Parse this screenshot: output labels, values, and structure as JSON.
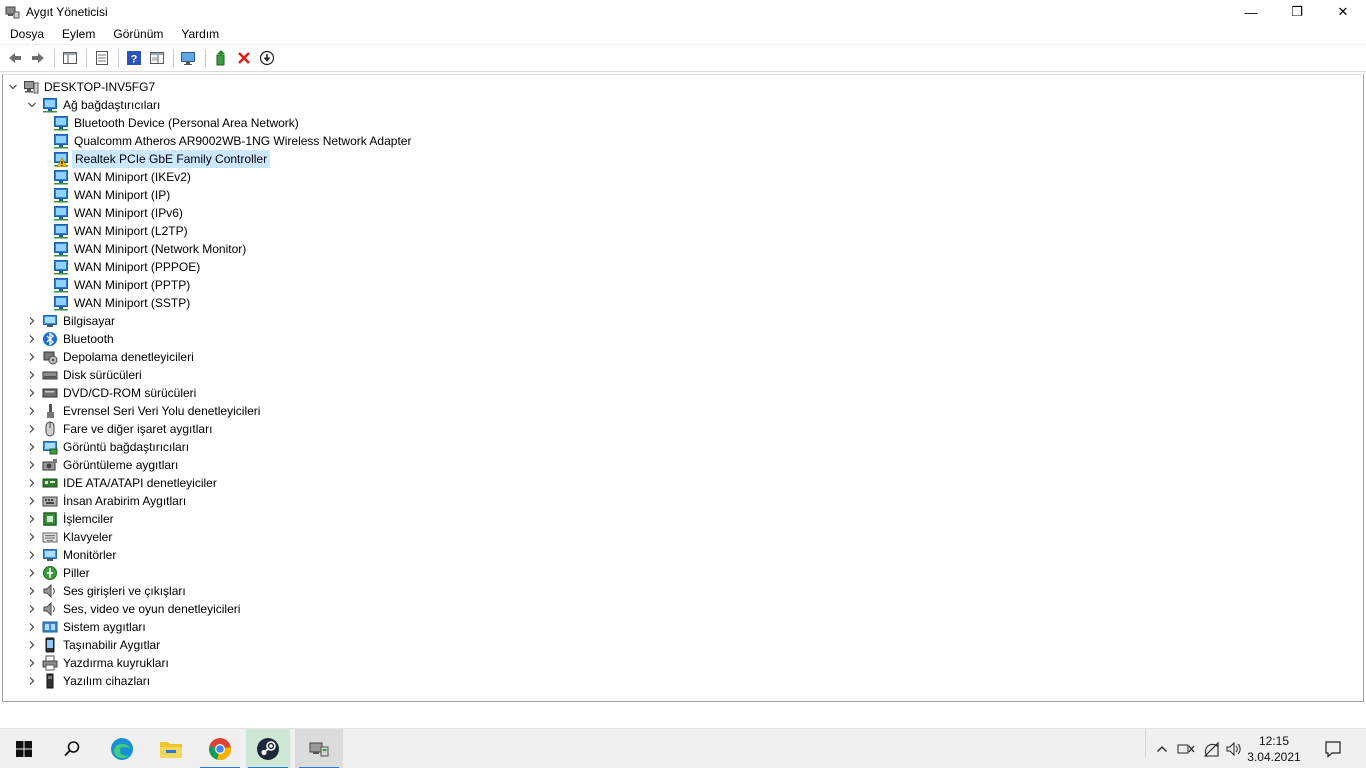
{
  "window": {
    "title": "Aygıt Yöneticisi",
    "minimize_glyph": "—",
    "maximize_glyph": "❐",
    "close_glyph": "✕"
  },
  "menu": [
    "Dosya",
    "Eylem",
    "Görünüm",
    "Yardım"
  ],
  "toolbar": {
    "icons": [
      "back-arrow-icon",
      "forward-arrow-icon",
      "show-hide-console-tree-icon",
      "properties-icon",
      "help-icon",
      "view-icon",
      "scan-hardware-icon",
      "update-driver-icon",
      "uninstall-device-icon",
      "disable-device-icon"
    ]
  },
  "tree": {
    "root": "DESKTOP-INV5FG7",
    "network_adapters": {
      "label": "Ağ bağdaştırıcıları",
      "items": [
        "Bluetooth Device (Personal Area Network)",
        "Qualcomm Atheros AR9002WB-1NG Wireless Network Adapter",
        "Realtek PCIe GbE Family Controller",
        "WAN Miniport (IKEv2)",
        "WAN Miniport (IP)",
        "WAN Miniport (IPv6)",
        "WAN Miniport (L2TP)",
        "WAN Miniport (Network Monitor)",
        "WAN Miniport (PPPOE)",
        "WAN Miniport (PPTP)",
        "WAN Miniport (SSTP)"
      ],
      "selected_item": "Realtek PCIe GbE Family Controller"
    },
    "categories": [
      "Bilgisayar",
      "Bluetooth",
      "Depolama denetleyicileri",
      "Disk sürücüleri",
      "DVD/CD-ROM sürücüleri",
      "Evrensel Seri Veri Yolu denetleyicileri",
      "Fare ve diğer işaret aygıtları",
      "Görüntü bağdaştırıcıları",
      "Görüntüleme aygıtları",
      "IDE ATA/ATAPI denetleyiciler",
      "İnsan Arabirim Aygıtları",
      "İşlemciler",
      "Klavyeler",
      "Monitörler",
      "Piller",
      "Ses girişleri ve çıkışları",
      "Ses, video ve oyun denetleyicileri",
      "Sistem aygıtları",
      "Taşınabilir Aygıtlar",
      "Yazdırma kuyrukları",
      "Yazılım cihazları"
    ]
  },
  "taskbar": {
    "apps": [
      "start-icon",
      "search-icon",
      "edge-icon",
      "file-explorer-icon",
      "chrome-icon",
      "steam-icon",
      "device-manager-icon"
    ],
    "clock_time": "12:15",
    "clock_date": "3.04.2021"
  },
  "colors": {
    "selection": "#cce8ff",
    "accent": "#2a78d6",
    "taskbar": "#f0f0f0"
  }
}
